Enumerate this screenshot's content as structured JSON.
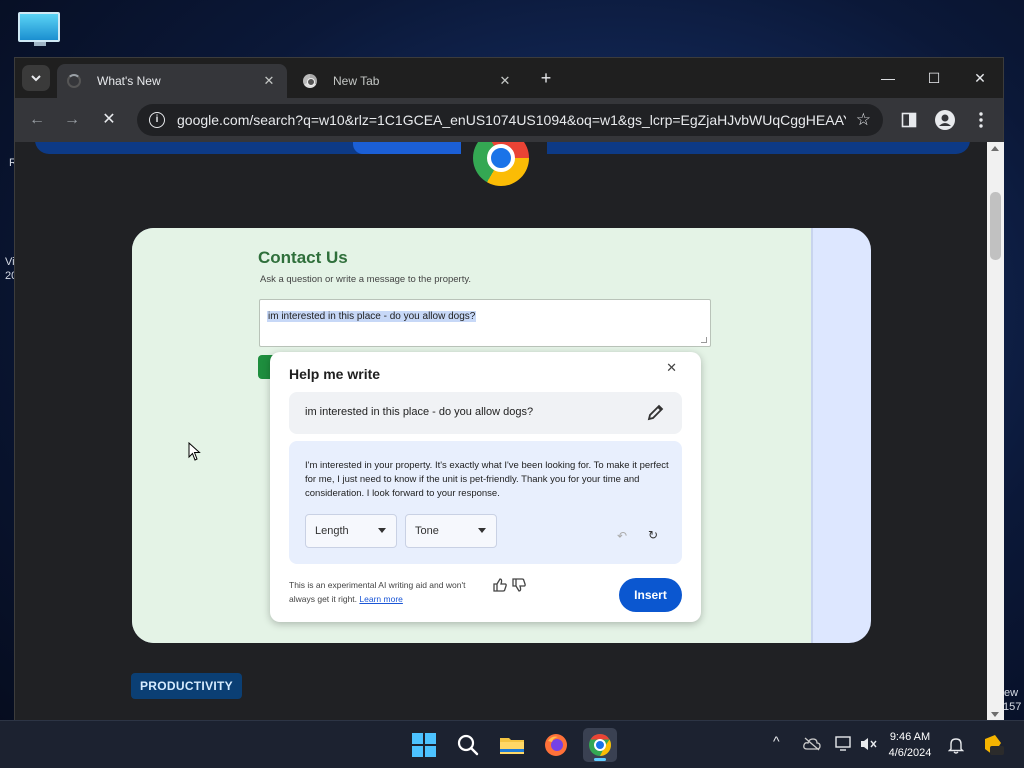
{
  "desktop": {
    "left_edge_texts": [
      "R",
      "Vi",
      "20"
    ],
    "right_edge_texts": [
      "ew",
      "157"
    ]
  },
  "browser": {
    "tabs": [
      {
        "title": "What's New",
        "active": true,
        "loading": true
      },
      {
        "title": "New Tab",
        "active": false
      }
    ],
    "tab_close_glyph": "✕",
    "new_tab_glyph": "+",
    "window_controls": {
      "minimize": "—",
      "maximize": "☐",
      "close": "✕"
    },
    "url": "google.com/search?q=w10&rlz=1C1GCEA_enUS1074US1094&oq=w1&gs_lcrp=EgZjaHJvbWUqCggHEAAY...",
    "nav": {
      "back": "←",
      "forward": "→",
      "stop": "✕",
      "info": "i",
      "bookmark": "☆"
    }
  },
  "page": {
    "contact": {
      "title": "Contact Us",
      "subtitle": "Ask a question or write a message to the property.",
      "message": "im interested in this place - do you allow dogs?"
    },
    "help_me_write": {
      "title": "Help me write",
      "close": "✕",
      "prompt": "im interested in this place - do you allow dogs?",
      "result": "I'm interested in your property. It's exactly what I've been looking for. To make it perfect for me, I just need to know if the unit is pet-friendly. Thank you for your time and consideration. I look forward to your response.",
      "length_label": "Length",
      "tone_label": "Tone",
      "undo_glyph": "↶",
      "retry_glyph": "↻",
      "disclaimer_text": "This is an experimental AI writing aid and won't always get it right.",
      "learn_more": "Learn more",
      "insert_label": "Insert"
    },
    "badge": "PRODUCTIVITY"
  },
  "taskbar": {
    "time": "9:46 AM",
    "date": "4/6/2024",
    "tray_chevron": "^"
  },
  "colors": {
    "accent_blue": "#0b57d0",
    "contact_green": "#2f6f3b",
    "card_green": "#e4f3e6",
    "card_lavender": "#dde7ff"
  }
}
